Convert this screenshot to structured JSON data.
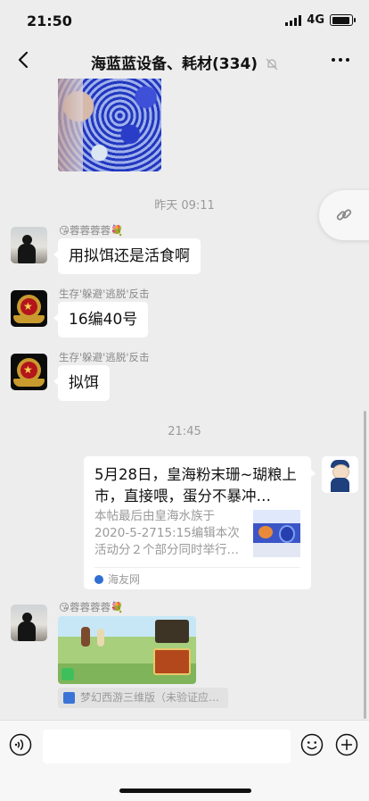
{
  "status_bar": {
    "time": "21:50",
    "network": "4G"
  },
  "header": {
    "title": "海蓝蓝设备、耗材(334)"
  },
  "messages": {
    "timestamp_1": "昨天 09:11",
    "m1": {
      "sender": "😘蓉蓉蓉蓉💐",
      "text": "用拟饵还是活食啊"
    },
    "m2": {
      "sender": "生存'躲避'逃脱'反击",
      "text": "16编40号"
    },
    "m3": {
      "sender": "生存'躲避'逃脱'反击",
      "text": "拟饵"
    },
    "timestamp_2": "21:45",
    "link_card": {
      "title": "5月28日，皇海粉末珊~瑚粮上市，直接喂，蛋分不暴冲…",
      "description": "本帖最后由皇海水族于2020-5-2715:15编辑本次活动分２个部分同时举行…",
      "source": "海友网"
    },
    "m5": {
      "sender": "😘蓉蓉蓉蓉💐",
      "mini_program": "梦幻西游三维版（未验证应…"
    }
  },
  "input": {
    "placeholder": ""
  }
}
